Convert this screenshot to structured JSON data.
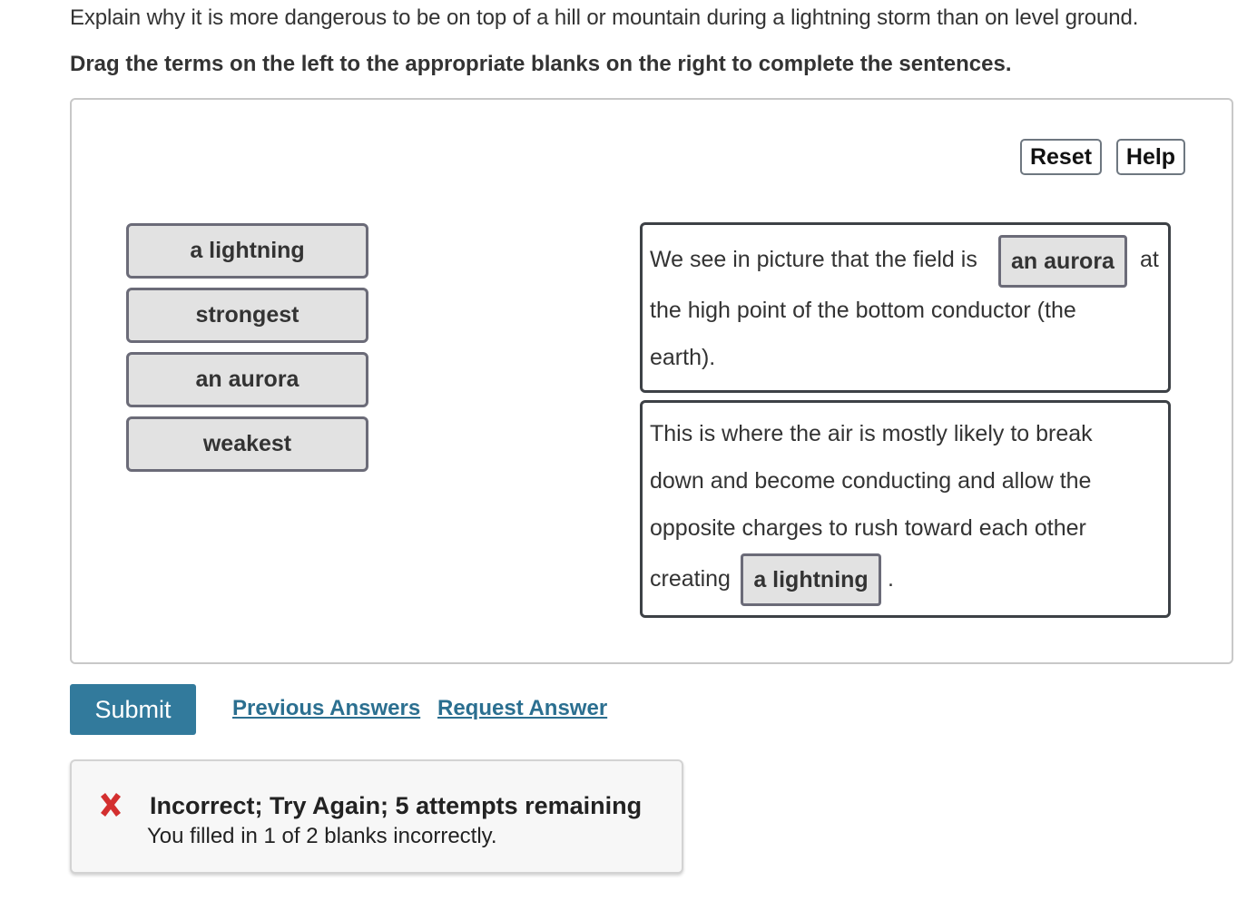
{
  "question": {
    "prompt": "Explain why it is more dangerous to be on top of a hill or mountain during a lightning storm than on level ground.",
    "instruction": "Drag the terms on the left to the appropriate blanks on the right to complete the sentences."
  },
  "toolbar": {
    "reset_label": "Reset",
    "help_label": "Help"
  },
  "terms": [
    {
      "label": "a lightning"
    },
    {
      "label": "strongest"
    },
    {
      "label": "an aurora"
    },
    {
      "label": "weakest"
    }
  ],
  "sentences": [
    {
      "before": "We see in picture that the field is",
      "blank": "an aurora",
      "after": "at",
      "line2": "the high point of the bottom conductor (the",
      "line3": "earth)."
    },
    {
      "line1": "This is where the air is mostly likely to break",
      "line2": "down and become conducting and allow the",
      "line3": "opposite charges to rush toward each other",
      "before": "creating",
      "blank": "a lightning",
      "after": "."
    }
  ],
  "actions": {
    "submit_label": "Submit",
    "previous_answers_label": "Previous Answers",
    "request_answer_label": "Request Answer"
  },
  "feedback": {
    "icon": "x-mark-icon",
    "title": "Incorrect; Try Again; 5 attempts remaining",
    "message": "You filled in 1 of 2 blanks incorrectly.",
    "status_color": "#d32f2f"
  },
  "colors": {
    "submit_bg": "#327a9c",
    "link": "#2b6f90"
  }
}
